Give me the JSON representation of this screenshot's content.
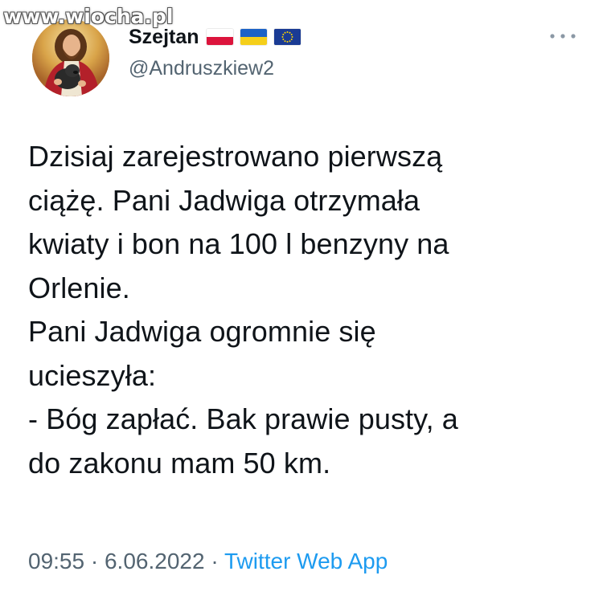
{
  "watermark": "www.wiocha.pl",
  "author": {
    "display_name": "Szejtan",
    "handle": "@Andruszkiew2",
    "flags": [
      "poland-flag",
      "ukraine-flag",
      "eu-flag"
    ]
  },
  "tweet": {
    "lines": [
      "Dzisiaj zarejestrowano pierwszą",
      "ciążę. Pani Jadwiga otrzymała",
      "kwiaty i bon na 100 l benzyny na",
      "Orlenie.",
      "Pani Jadwiga ogromnie się",
      "ucieszyła:",
      "- Bóg zapłać. Bak prawie pusty, a",
      "do zakonu mam 50 km."
    ]
  },
  "meta": {
    "time": "09:55",
    "separator": "·",
    "date": "6.06.2022",
    "source": "Twitter Web App"
  },
  "colors": {
    "text": "#0f1419",
    "secondary": "#536471",
    "link": "#1d9bf0"
  }
}
